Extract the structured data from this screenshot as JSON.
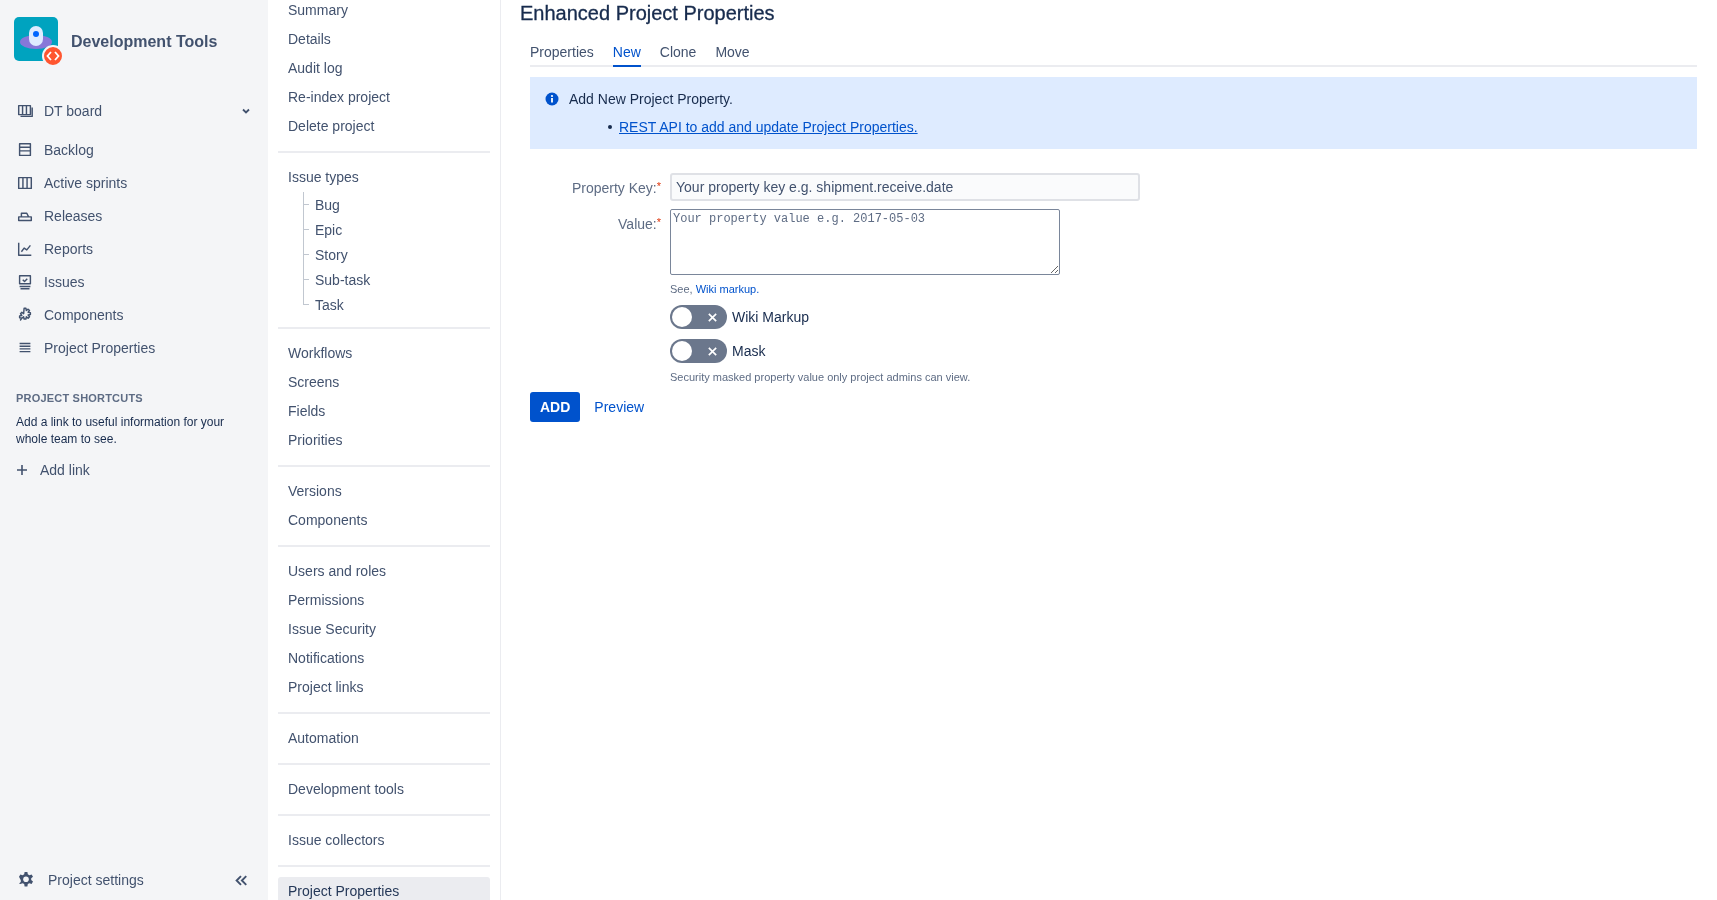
{
  "sidebar": {
    "project_name": "Development Tools",
    "board": {
      "label": "DT board"
    },
    "items": [
      {
        "label": "Backlog"
      },
      {
        "label": "Active sprints"
      },
      {
        "label": "Releases"
      },
      {
        "label": "Reports"
      },
      {
        "label": "Issues"
      },
      {
        "label": "Components"
      },
      {
        "label": "Project Properties"
      }
    ],
    "shortcuts": {
      "heading": "PROJECT SHORTCUTS",
      "text": "Add a link to useful information for your whole team to see.",
      "add_link": "Add link"
    },
    "footer": {
      "label": "Project settings"
    }
  },
  "settings_nav": {
    "sections": [
      {
        "items": [
          {
            "label": "Summary",
            "selected": false
          },
          {
            "label": "Details",
            "selected": false
          },
          {
            "label": "Audit log",
            "selected": false
          },
          {
            "label": "Re-index project",
            "selected": false
          },
          {
            "label": "Delete project",
            "selected": false
          }
        ]
      },
      {
        "items": [
          {
            "label": "Issue types",
            "selected": false,
            "children": [
              {
                "label": "Bug",
                "selected": false
              },
              {
                "label": "Epic",
                "selected": false
              },
              {
                "label": "Story",
                "selected": false
              },
              {
                "label": "Sub-task",
                "selected": false
              },
              {
                "label": "Task",
                "selected": false
              }
            ]
          }
        ]
      },
      {
        "items": [
          {
            "label": "Workflows",
            "selected": false
          },
          {
            "label": "Screens",
            "selected": false
          },
          {
            "label": "Fields",
            "selected": false
          },
          {
            "label": "Priorities",
            "selected": false
          }
        ]
      },
      {
        "items": [
          {
            "label": "Versions",
            "selected": false
          },
          {
            "label": "Components",
            "selected": false
          }
        ]
      },
      {
        "items": [
          {
            "label": "Users and roles",
            "selected": false
          },
          {
            "label": "Permissions",
            "selected": false
          },
          {
            "label": "Issue Security",
            "selected": false
          },
          {
            "label": "Notifications",
            "selected": false
          },
          {
            "label": "Project links",
            "selected": false
          }
        ]
      },
      {
        "items": [
          {
            "label": "Automation",
            "selected": false
          }
        ]
      },
      {
        "items": [
          {
            "label": "Development tools",
            "selected": false
          }
        ]
      },
      {
        "items": [
          {
            "label": "Issue collectors",
            "selected": false
          }
        ]
      },
      {
        "items": [
          {
            "label": "Project Properties",
            "selected": true
          }
        ]
      }
    ]
  },
  "page": {
    "title": "Enhanced Project Properties",
    "tabs": [
      {
        "label": "Properties",
        "selected": false
      },
      {
        "label": "New",
        "selected": true
      },
      {
        "label": "Clone",
        "selected": false
      },
      {
        "label": "Move",
        "selected": false
      }
    ],
    "info": {
      "message": "Add New Project Property.",
      "link": "REST API to add and update Project Properties."
    },
    "form": {
      "fields": [
        {
          "kind": "input",
          "label": "Property Key:",
          "required_mark": "*",
          "placeholder": "Your property key e.g. shipment.receive.date"
        },
        {
          "kind": "textarea",
          "label": "Value:",
          "required_mark": "*",
          "placeholder": "Your property value e.g. 2017-05-03"
        }
      ],
      "help": {
        "text": "See,",
        "link": "Wiki markup."
      },
      "toggles": [
        {
          "label": "Wiki Markup",
          "on": false
        },
        {
          "label": "Mask",
          "on": false
        }
      ],
      "note": "Security masked property value only project admins can view.",
      "buttons": {
        "primary": "ADD",
        "secondary": "Preview"
      }
    }
  }
}
